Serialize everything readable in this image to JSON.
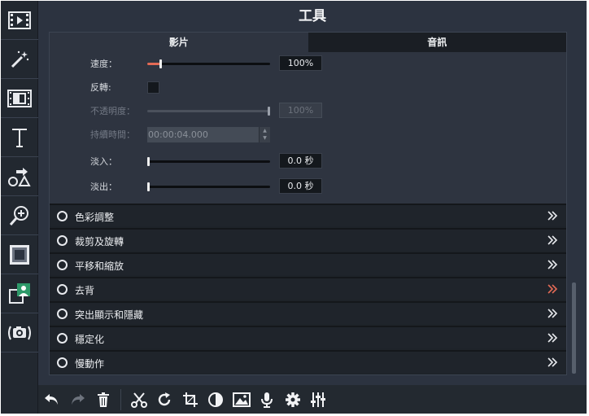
{
  "panel": {
    "title": "工具"
  },
  "tabs": [
    {
      "label": "影片",
      "active": true
    },
    {
      "label": "音訊",
      "active": false
    }
  ],
  "properties": {
    "speed": {
      "label": "速度：",
      "value": "100%",
      "level": 0.1
    },
    "reverse": {
      "label": "反轉:",
      "checked": false
    },
    "opacity": {
      "label": "不透明度：",
      "value": "100%",
      "level": 1.0,
      "disabled": true
    },
    "duration": {
      "label": "持續時間：",
      "value": "00:00:04.000",
      "disabled": true
    },
    "fade_in": {
      "label": "淡入：",
      "value": "0.0 秒",
      "level": 0.0
    },
    "fade_out": {
      "label": "淡出：",
      "value": "0.0 秒",
      "level": 0.0
    }
  },
  "sections": [
    {
      "label": "色彩調整",
      "highlighted": false
    },
    {
      "label": "裁剪及旋轉",
      "highlighted": false
    },
    {
      "label": "平移和縮放",
      "highlighted": false
    },
    {
      "label": "去背",
      "highlighted": true
    },
    {
      "label": "突出顯示和隱藏",
      "highlighted": false
    },
    {
      "label": "穩定化",
      "highlighted": false
    },
    {
      "label": "慢動作",
      "highlighted": false
    }
  ],
  "colors": {
    "accent": "#e26a56",
    "panel_bg": "#2c3340",
    "row_bg": "#1f242b"
  },
  "left_toolbar_icons": [
    "film-icon",
    "magic-wand-icon",
    "clip-icon",
    "text-icon",
    "shapes-icon",
    "zoom-in-icon",
    "texture-icon",
    "picture-in-picture-icon",
    "camera-icon"
  ],
  "bottom_toolbar_icons": [
    "undo-icon",
    "redo-icon",
    "trash-icon",
    "scissors-icon",
    "rotate-icon",
    "crop-icon",
    "contrast-icon",
    "image-icon",
    "microphone-icon",
    "gear-icon",
    "sliders-icon"
  ]
}
